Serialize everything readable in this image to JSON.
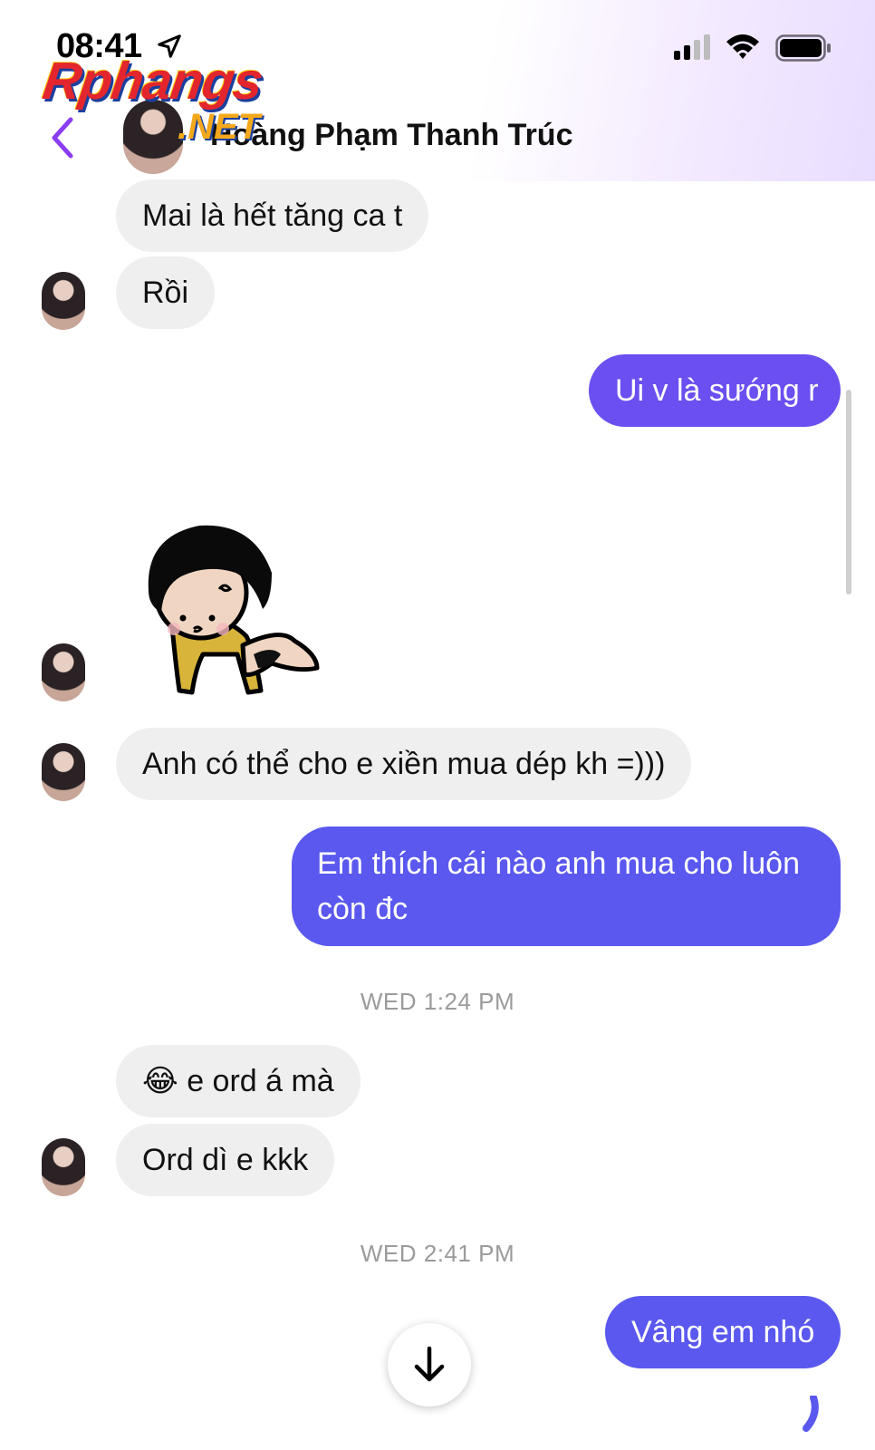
{
  "status_bar": {
    "time": "08:41"
  },
  "watermark": {
    "brand": "Rphangs",
    "suffix": ".NET"
  },
  "header": {
    "contact_name": "Hoàng Phạm Thanh Trúc"
  },
  "messages": [
    {
      "from": "them",
      "text": "Mai là hết tăng ca t"
    },
    {
      "from": "them",
      "text": "Rồi"
    },
    {
      "from": "me",
      "text": "Ui v là sướng r"
    },
    {
      "from": "them",
      "type": "sticker",
      "icon": "crawling-girl-sticker"
    },
    {
      "from": "them",
      "text": "Anh có thể cho e xiền mua dép kh =)))"
    },
    {
      "from": "me",
      "text_line1": "Em thích cái nào anh mua cho luôn",
      "text_line2": "còn đc"
    },
    {
      "from": "them",
      "emoji": "😂",
      "text": "e ord á mà"
    },
    {
      "from": "them",
      "text": "Ord dì e kkk"
    },
    {
      "from": "me",
      "text": "Vâng em nhó"
    }
  ],
  "timestamps": {
    "first": "WED 1:24 PM",
    "second": "WED 2:41 PM"
  },
  "colors": {
    "outgoing_bubble": "#5a58ee",
    "outgoing_bubble_top": "#6b4ff0",
    "incoming_bubble": "#efefef",
    "back_arrow": "#8b3df2"
  }
}
